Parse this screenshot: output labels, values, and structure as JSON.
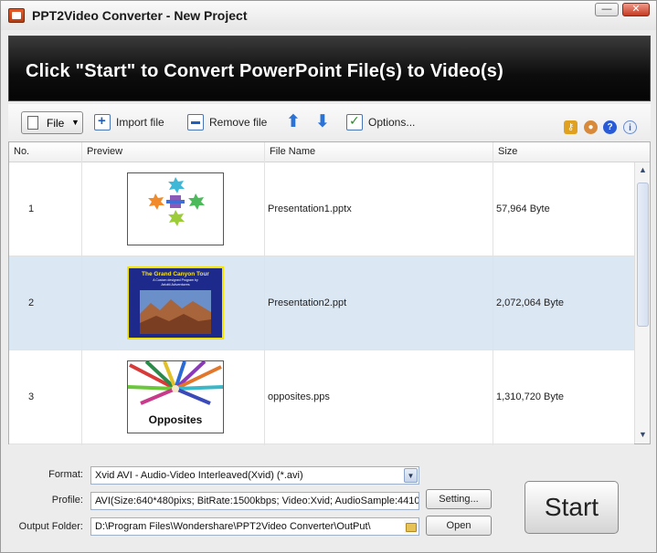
{
  "window": {
    "title": "PPT2Video Converter - New Project",
    "minimize_label": "—",
    "close_label": "✕"
  },
  "banner": {
    "text": "Click \"Start\" to Convert PowerPoint File(s) to Video(s)"
  },
  "toolbar": {
    "file_label": "File",
    "import_label": "Import file",
    "remove_label": "Remove file",
    "options_label": "Options...",
    "right_icons": [
      "key-icon",
      "user-icon",
      "help-icon",
      "info-icon"
    ]
  },
  "table": {
    "headers": {
      "no": "No.",
      "preview": "Preview",
      "file_name": "File Name",
      "size": "Size"
    },
    "rows": [
      {
        "no": "1",
        "file_name": "Presentation1.pptx",
        "size": "57,964 Byte",
        "selected": false
      },
      {
        "no": "2",
        "file_name": "Presentation2.ppt",
        "size": "2,072,064 Byte",
        "selected": true
      },
      {
        "no": "3",
        "file_name": "opposites.pps",
        "size": "1,310,720 Byte",
        "selected": false
      }
    ],
    "thumb2": {
      "title": "The Grand Canyon Tour",
      "subtitle": "A Custom designed Program by",
      "company": "Ariotti Adventures"
    },
    "thumb3": {
      "caption": "Opposites"
    }
  },
  "settings": {
    "format_label": "Format:",
    "format_value": "Xvid AVI - Audio-Video Interleaved(Xvid) (*.avi)",
    "profile_label": "Profile:",
    "profile_value": "AVI(Size:640*480pixs; BitRate:1500kbps; Video:Xvid; AudioSample:44100",
    "output_label": "Output Folder:",
    "output_value": "D:\\Program Files\\Wondershare\\PPT2Video Converter\\OutPut\\",
    "setting_button": "Setting...",
    "open_button": "Open",
    "start_button": "Start"
  },
  "colors": {
    "banner_bg": "#0d0d0d",
    "selection_bg": "#dce7f4",
    "accent_blue": "#2a72d6"
  }
}
